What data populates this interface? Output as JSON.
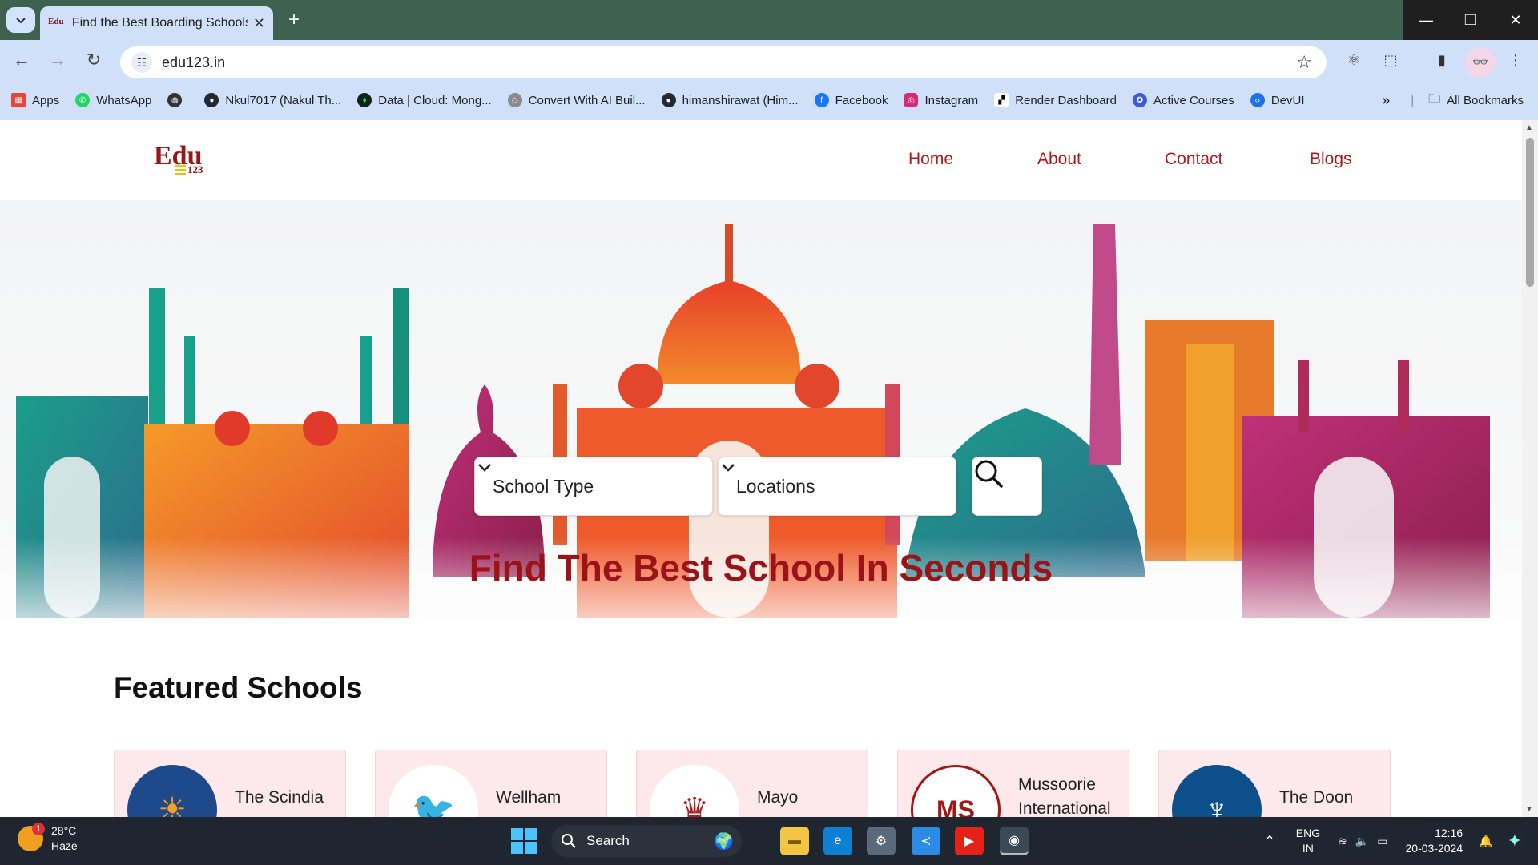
{
  "browser": {
    "tab_title": "Find the Best Boarding Schools",
    "url": "edu123.in",
    "bookmarks": [
      {
        "label": "Apps",
        "color": "#e9443a"
      },
      {
        "label": "WhatsApp",
        "color": "#25d366"
      },
      {
        "label": "",
        "color": "#333333"
      },
      {
        "label": "Nkul7017 (Nakul Th...",
        "color": "#24292f"
      },
      {
        "label": "Data | Cloud: Mong...",
        "color": "#11221a"
      },
      {
        "label": "Convert With AI Buil...",
        "color": "#8a8a8a"
      },
      {
        "label": "himanshirawat (Him...",
        "color": "#24292f"
      },
      {
        "label": "Facebook",
        "color": "#1877f2"
      },
      {
        "label": "Instagram",
        "color": "#d62976"
      },
      {
        "label": "Render Dashboard",
        "color": "#ffffff"
      },
      {
        "label": "Active Courses",
        "color": "#3b5bdb"
      },
      {
        "label": "DevUI",
        "color": "#1a73e8"
      }
    ],
    "all_bookmarks": "All Bookmarks"
  },
  "site": {
    "logo_main": "Edu",
    "logo_sub": "123",
    "nav": [
      "Home",
      "About",
      "Contact",
      "Blogs"
    ],
    "nav_color": "#b0191b"
  },
  "hero": {
    "school_type": "School Type",
    "locations": "Locations",
    "title": "Find The Best School In Seconds",
    "title_color": "#9c1219"
  },
  "featured": {
    "title": "Featured Schools",
    "schools": [
      {
        "name": "The Scindia",
        "logo_bg": "#1e4a8c"
      },
      {
        "name": "Wellham",
        "logo_bg": "#ffffff"
      },
      {
        "name": "Mayo",
        "logo_bg": "#ffffff"
      },
      {
        "name": "Mussoorie International",
        "logo_bg": "#ffffff"
      },
      {
        "name": "The Doon",
        "logo_bg": "#0d4f8b"
      }
    ]
  },
  "taskbar": {
    "temp": "28°C",
    "weather": "Haze",
    "badge": "1",
    "search": "Search",
    "lang1": "ENG",
    "lang2": "IN",
    "time": "12:16",
    "date": "20-03-2024"
  }
}
